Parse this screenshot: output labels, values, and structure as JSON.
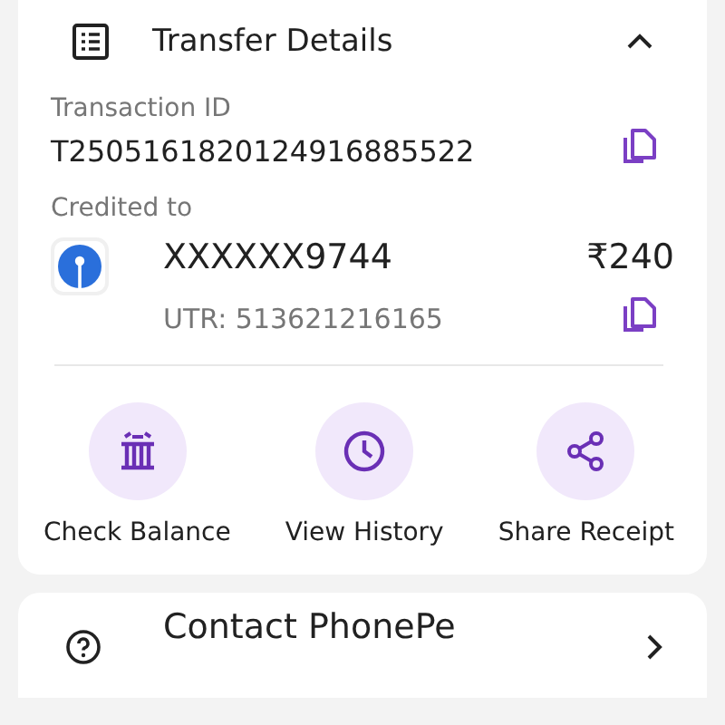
{
  "transfer_details": {
    "title": "Transfer Details",
    "expanded": true,
    "transaction_id": {
      "label": "Transaction ID",
      "value": "T2505161820124916885522"
    },
    "credited_to": {
      "label": "Credited to",
      "account": "XXXXXX9744",
      "amount": "₹240",
      "utr": "UTR: 513621216165"
    },
    "actions": [
      {
        "kind": "bank",
        "label": "Check Balance"
      },
      {
        "kind": "history",
        "label": "View History"
      },
      {
        "kind": "share",
        "label": "Share Receipt"
      }
    ]
  },
  "support": {
    "title": "Contact PhonePe"
  }
}
